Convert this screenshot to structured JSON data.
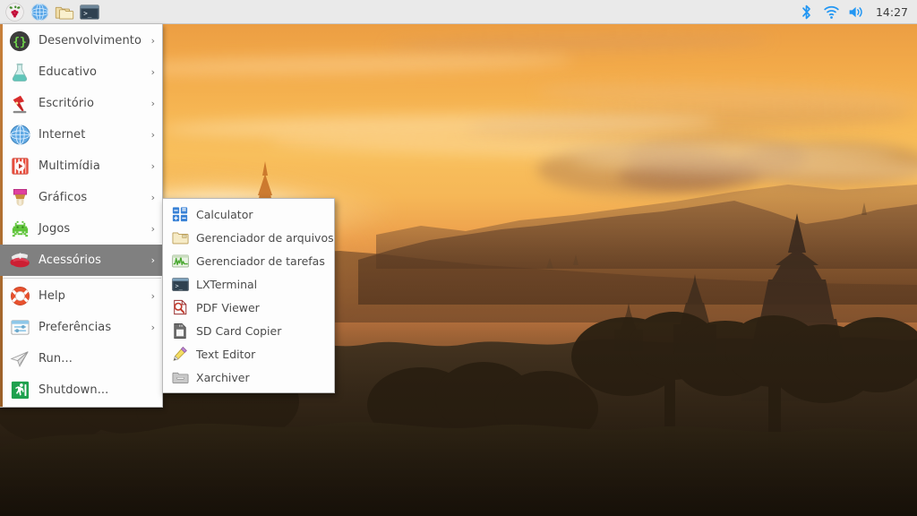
{
  "desktop": {
    "wallpaper_description": "Sunset over Bagan temples with pagoda silhouettes",
    "colors": {
      "sky_top": "#e9953c",
      "sky_mid": "#f8bf5c",
      "sky_low": "#8d5b33",
      "ground": "#241a0f",
      "taskbar_bg": "#eaeaea",
      "menu_bg": "#fdfdfd",
      "menu_text": "#4b4b4b",
      "menu_highlight_bg": "#808080",
      "menu_highlight_text": "#ffffff",
      "accent_left_strip": "#c8803a",
      "tray_blue": "#2196f3"
    }
  },
  "taskbar": {
    "launchers": [
      {
        "name": "raspberry-menu-button",
        "icon": "raspberry-icon",
        "label": "Menu"
      },
      {
        "name": "web-browser-launcher",
        "icon": "globe-icon",
        "label": "Web Browser"
      },
      {
        "name": "file-manager-launcher",
        "icon": "folders-icon",
        "label": "File Manager"
      },
      {
        "name": "terminal-launcher",
        "icon": "terminal-icon",
        "label": "Terminal"
      }
    ],
    "tray": [
      {
        "name": "bluetooth-tray-icon",
        "icon": "bluetooth-icon",
        "label": "Bluetooth"
      },
      {
        "name": "wifi-tray-icon",
        "icon": "wifi-icon",
        "label": "Wireless Network"
      },
      {
        "name": "volume-tray-icon",
        "icon": "speaker-icon",
        "label": "Volume"
      }
    ],
    "clock": "14:27"
  },
  "main_menu": {
    "items": [
      {
        "label": "Desenvolvimento",
        "icon": "braces-icon",
        "arrow": "›",
        "selected": false
      },
      {
        "label": "Educativo",
        "icon": "flask-icon",
        "arrow": "›",
        "selected": false
      },
      {
        "label": "Escritório",
        "icon": "desk-lamp-icon",
        "arrow": "›",
        "selected": false
      },
      {
        "label": "Internet",
        "icon": "globe-icon",
        "arrow": "›",
        "selected": false
      },
      {
        "label": "Multimídia",
        "icon": "film-icon",
        "arrow": "›",
        "selected": false
      },
      {
        "label": "Gráficos",
        "icon": "paintbrush-icon",
        "arrow": "›",
        "selected": false
      },
      {
        "label": "Jogos",
        "icon": "alien-icon",
        "arrow": "›",
        "selected": false
      },
      {
        "label": "Acessórios",
        "icon": "swiss-knife-icon",
        "arrow": "›",
        "selected": true
      },
      {
        "label": "Help",
        "icon": "lifebuoy-icon",
        "arrow": "›",
        "selected": false
      },
      {
        "label": "Preferências",
        "icon": "sliders-icon",
        "arrow": "›",
        "selected": false
      },
      {
        "label": "Run...",
        "icon": "paper-plane-icon",
        "arrow": "",
        "selected": false
      },
      {
        "label": "Shutdown...",
        "icon": "exit-runner-icon",
        "arrow": "",
        "selected": false
      }
    ],
    "separator_after_index": 7
  },
  "submenu": {
    "parent": "Acessórios",
    "items": [
      {
        "label": "Calculator",
        "icon": "calculator-icon"
      },
      {
        "label": "Gerenciador de arquivos",
        "icon": "file-manager-icon"
      },
      {
        "label": "Gerenciador de tarefas",
        "icon": "task-manager-icon"
      },
      {
        "label": "LXTerminal",
        "icon": "terminal-icon"
      },
      {
        "label": "PDF Viewer",
        "icon": "pdf-viewer-icon"
      },
      {
        "label": "SD Card Copier",
        "icon": "sd-card-icon"
      },
      {
        "label": "Text Editor",
        "icon": "pencil-icon"
      },
      {
        "label": "Xarchiver",
        "icon": "archive-icon"
      }
    ]
  }
}
